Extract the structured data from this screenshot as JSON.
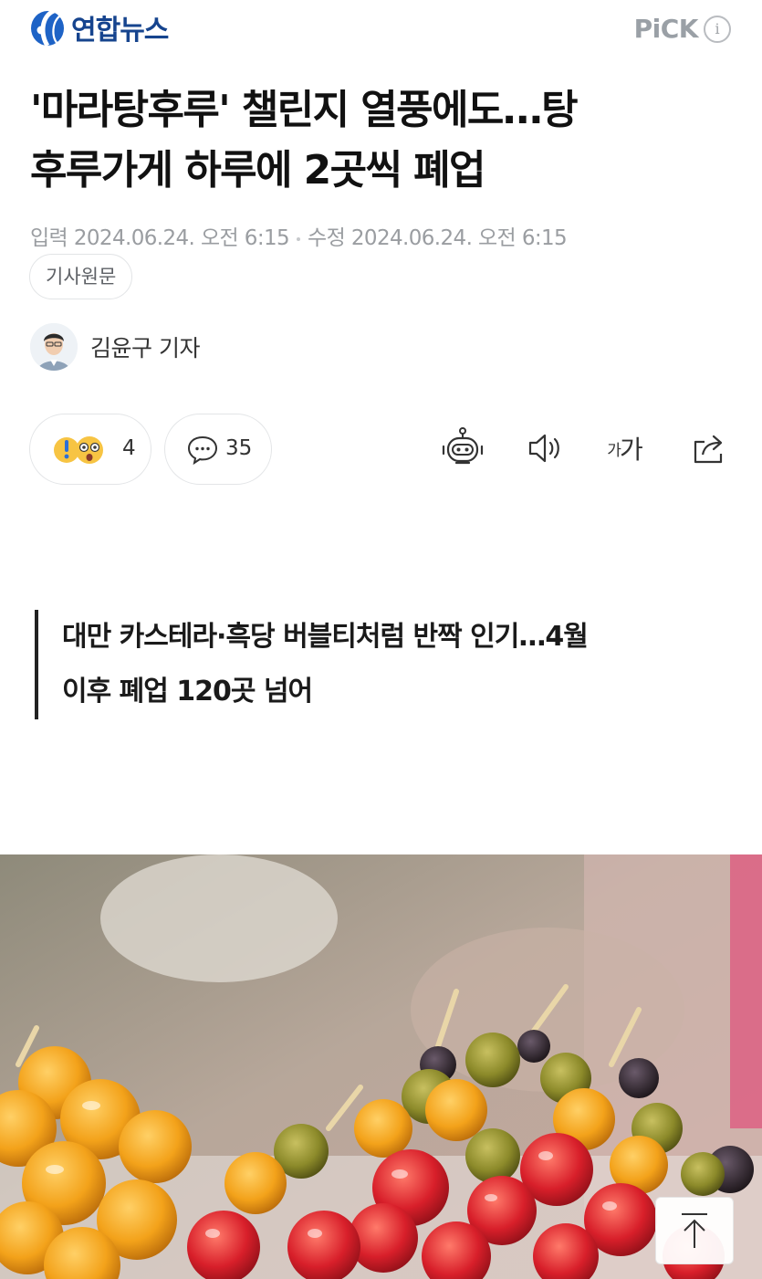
{
  "header": {
    "logo_text": "연합뉴스",
    "pick_label": "PiCK",
    "info_label": "i"
  },
  "article": {
    "title_lines": [
      "'마라탕후루' 챌린지 열풍에도…탕",
      "후루가게 하루에 2곳씩 폐업"
    ],
    "input_label": "입력",
    "input_datetime": "2024.06.24. 오전 6:15",
    "modified_label": "수정",
    "modified_datetime": "2024.06.24. 오전 6:15",
    "origin_button": "기사원문",
    "author": "김윤구 기자",
    "subhead_lines": [
      "대만 카스테라·흑당 버블티처럼 반짝 인기…4월",
      "이후 폐업 120곳 넘어"
    ]
  },
  "actions": {
    "reaction_count": "4",
    "comment_count": "35",
    "font_label_small": "가",
    "font_label_large": "가",
    "icons": [
      "summary-bot-icon",
      "speaker-icon",
      "font-size-icon",
      "share-icon"
    ]
  },
  "colors": {
    "brand_blue": "#16448e",
    "text_dark": "#111111",
    "meta_gray": "#9a9da1"
  }
}
